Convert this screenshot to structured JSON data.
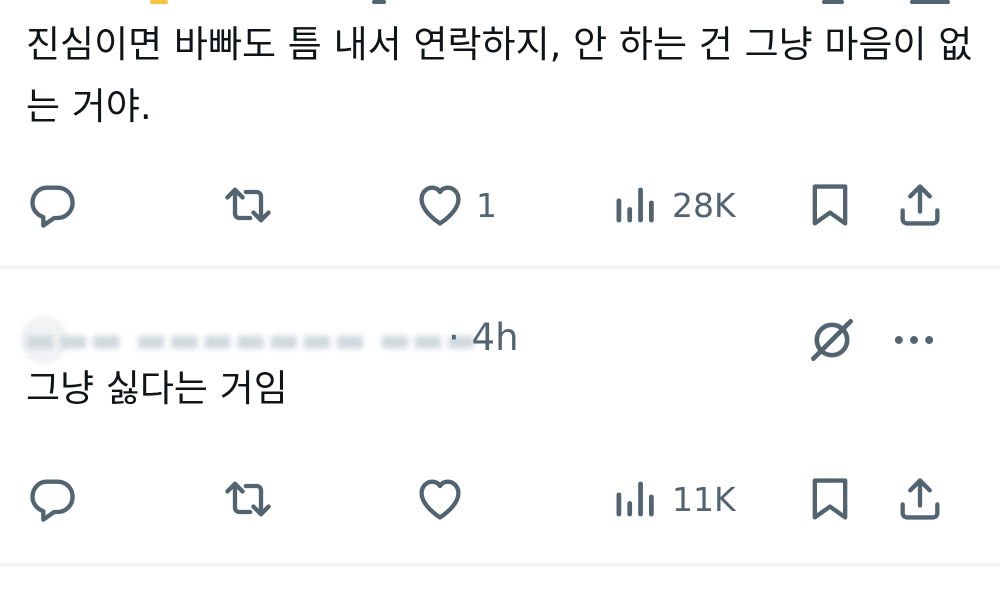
{
  "post1": {
    "text": "진심이면 바빠도 틈 내서 연락하지, 안 하는 건 그냥 마음이 없는 거야.",
    "actions": {
      "replies": "",
      "reposts": "",
      "likes": "1",
      "views": "28K"
    }
  },
  "post2": {
    "meta": "· 4h",
    "text": "그냥 싫다는 거임",
    "actions": {
      "replies": "",
      "reposts": "",
      "likes": "",
      "views": "11K"
    }
  },
  "icons": {
    "reply": "reply-icon",
    "repost": "repost-icon",
    "like": "heart-icon",
    "views": "views-icon",
    "bookmark": "bookmark-icon",
    "share": "share-icon",
    "grok": "grok-icon",
    "more": "more-icon"
  },
  "colors": {
    "text": "#0f1419",
    "secondary": "#536471",
    "divider": "#eff3f4"
  }
}
